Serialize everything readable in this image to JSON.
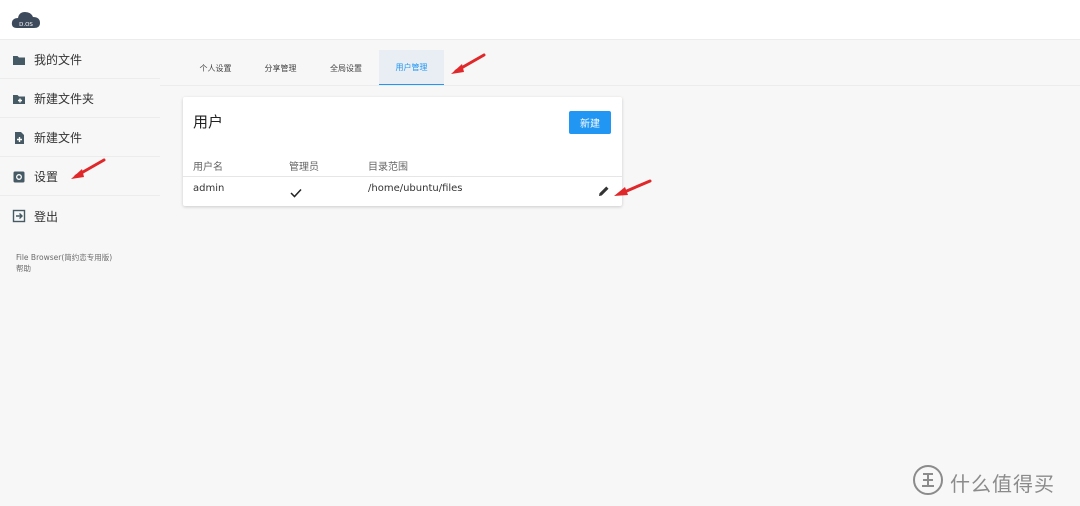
{
  "logo": {
    "text": "D.OS",
    "icon": "cloud-logo-icon",
    "color": "#3d4a5c"
  },
  "sidebar": {
    "items": [
      {
        "label": "我的文件",
        "icon": "folder-icon"
      },
      {
        "label": "新建文件夹",
        "icon": "new-folder-icon"
      },
      {
        "label": "新建文件",
        "icon": "new-file-icon"
      },
      {
        "label": "设置",
        "icon": "settings-icon"
      },
      {
        "label": "登出",
        "icon": "logout-icon"
      }
    ],
    "footer": {
      "app_name": "File Browser(简约恋专用版)",
      "help": "帮助"
    }
  },
  "tabs": [
    {
      "label": "个人设置",
      "active": false
    },
    {
      "label": "分享管理",
      "active": false
    },
    {
      "label": "全局设置",
      "active": false
    },
    {
      "label": "用户管理",
      "active": true
    }
  ],
  "users_card": {
    "title": "用户",
    "new_button": "新建",
    "columns": [
      "用户名",
      "管理员",
      "目录范围"
    ],
    "rows": [
      {
        "username": "admin",
        "admin": true,
        "scope": "/home/ubuntu/files",
        "edit_icon": "edit-pencil-icon"
      }
    ]
  },
  "watermark": {
    "text": "什么值得买",
    "icon": "zhi-logo-icon"
  },
  "colors": {
    "accent": "#2196f3",
    "annotation_arrow": "#e0272a",
    "background": "#f7f7f8"
  }
}
